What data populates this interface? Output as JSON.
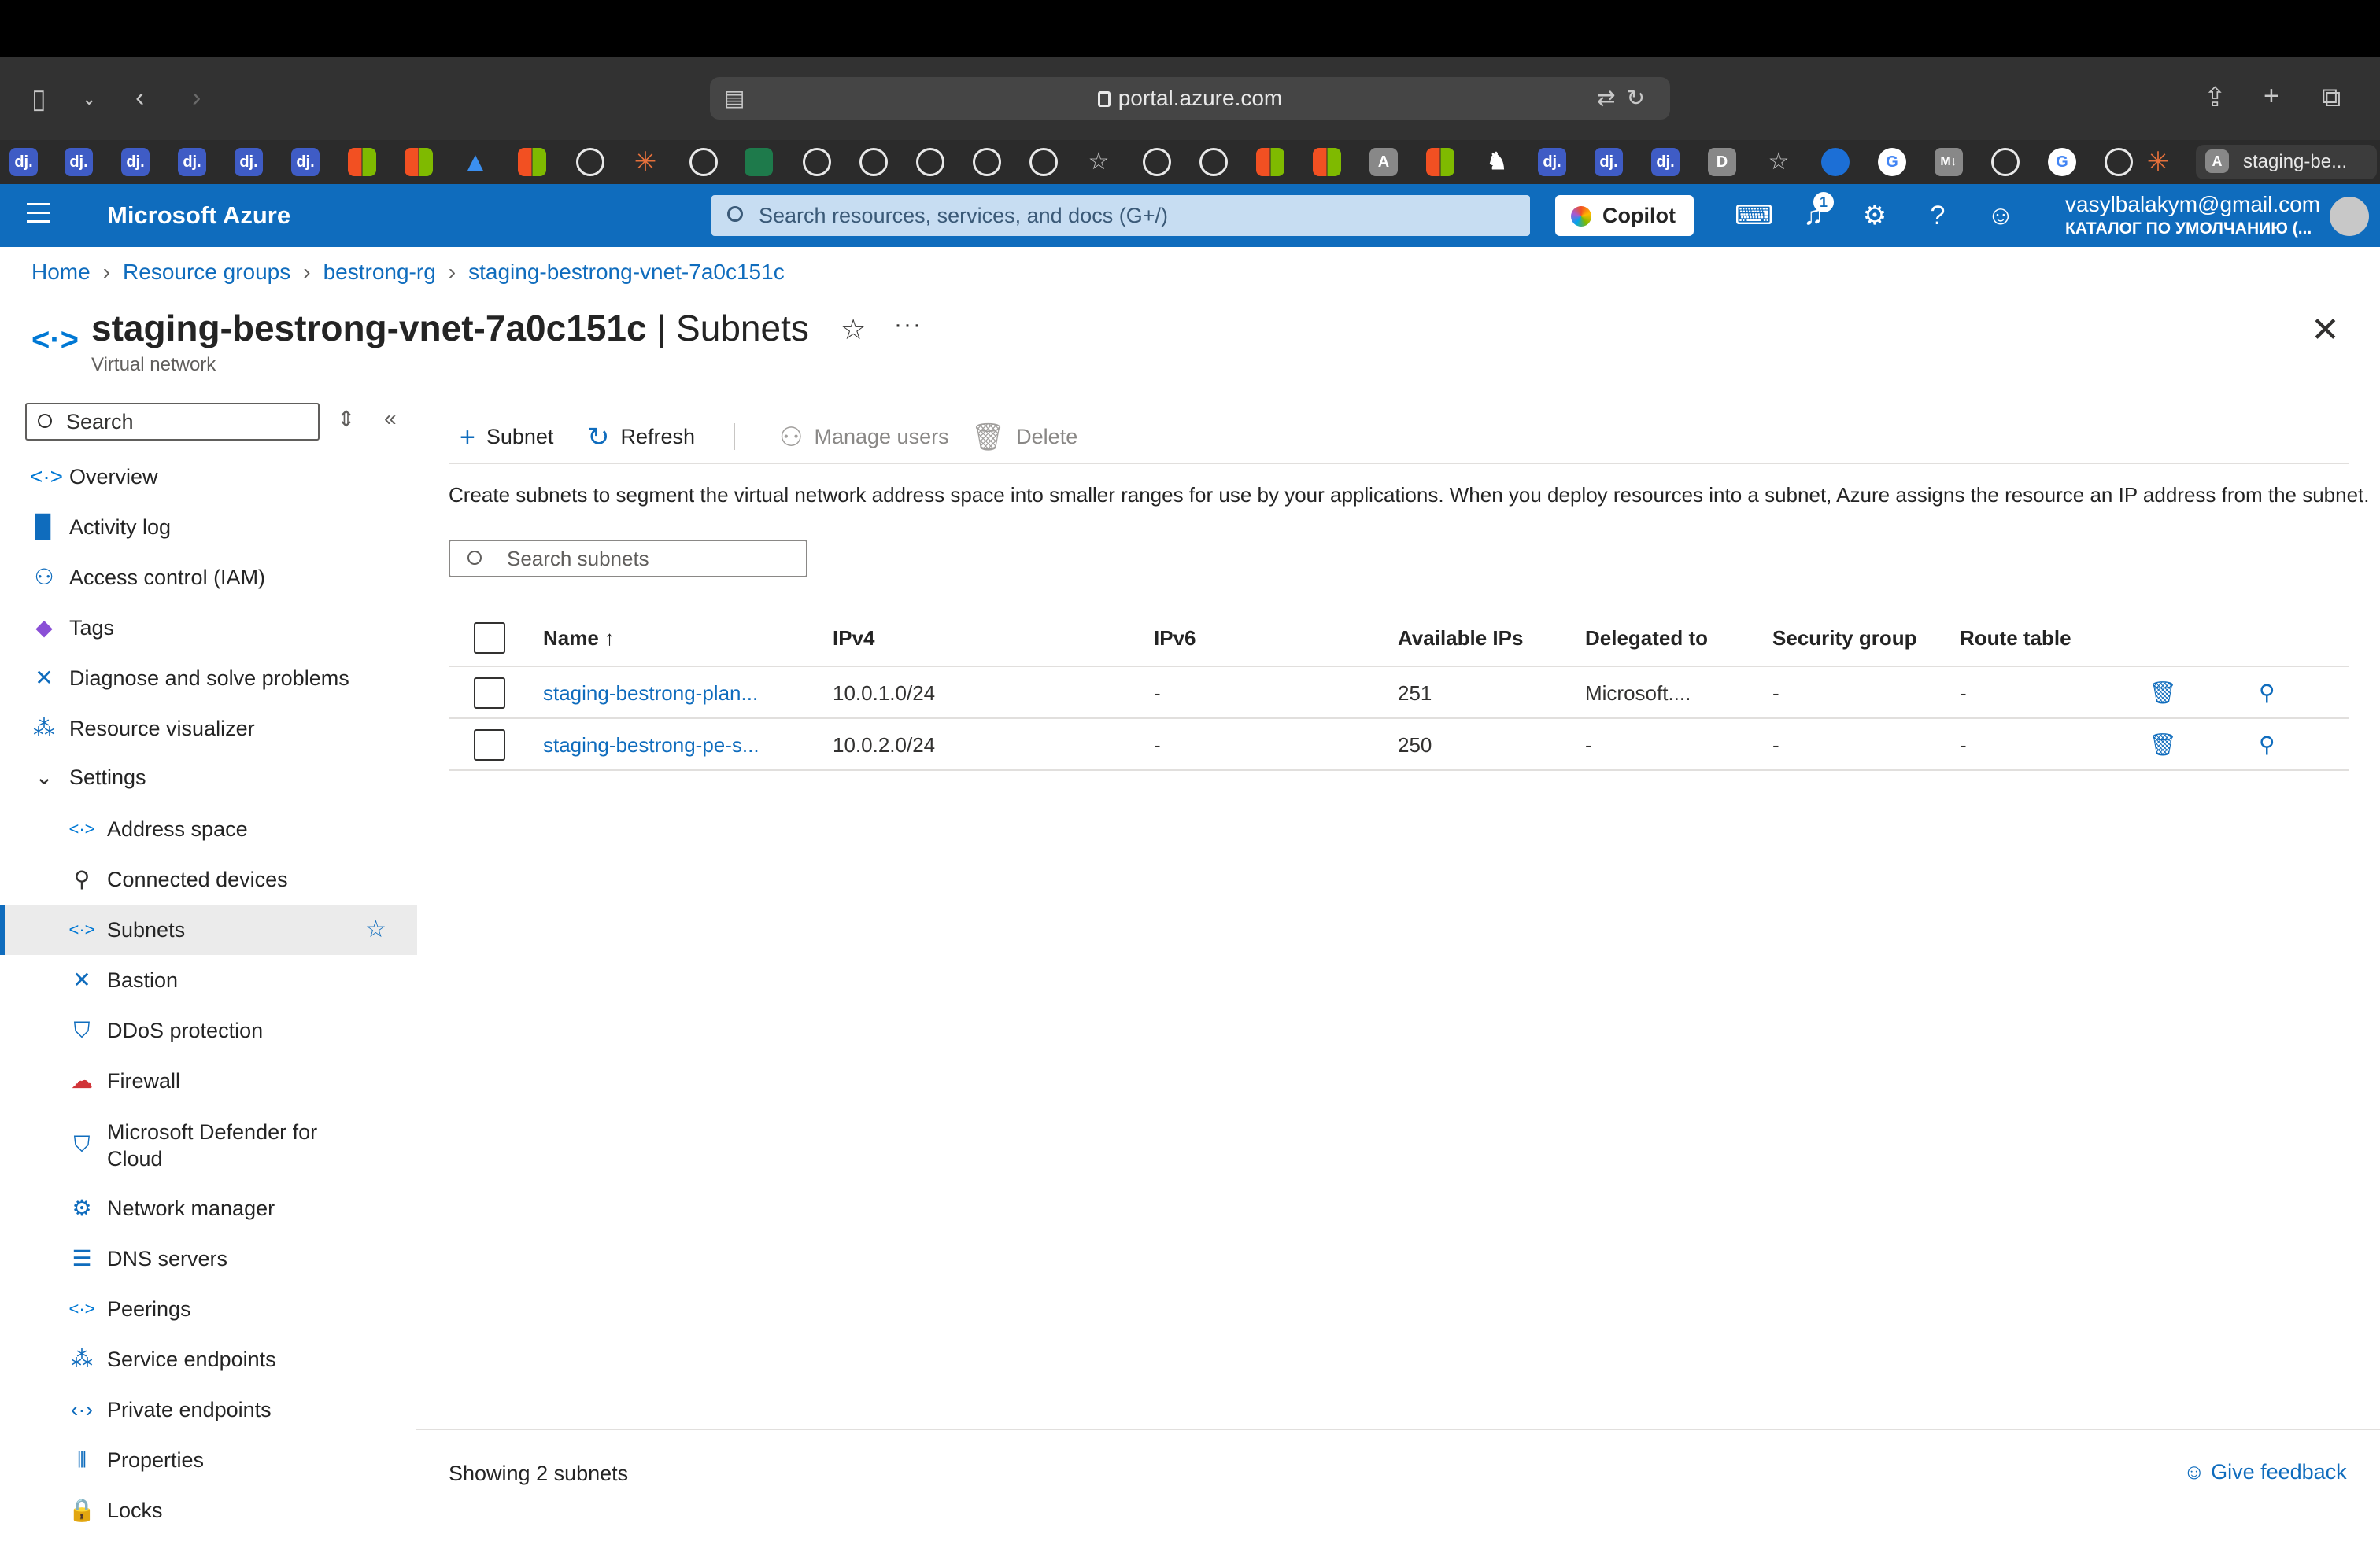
{
  "browser": {
    "url": "portal.azure.com",
    "tab_title": "staging-be...",
    "bookmarks": [
      "dj.",
      "dj.",
      "dj.",
      "dj.",
      "dj.",
      "dj.",
      "A",
      "D",
      "M↓",
      "A"
    ]
  },
  "header": {
    "brand": "Microsoft Azure",
    "search_placeholder": "Search resources, services, and docs (G+/)",
    "copilot_label": "Copilot",
    "notifications_count": "1",
    "user_email": "vasylbalakym@gmail.com",
    "user_directory": "КАТАЛОГ ПО УМОЛЧАНИЮ (..."
  },
  "breadcrumb": [
    "Home",
    "Resource groups",
    "bestrong-rg",
    "staging-bestrong-vnet-7a0c151c"
  ],
  "page": {
    "title_resource": "staging-bestrong-vnet-7a0c151c",
    "title_section": " | Subnets",
    "subtitle": "Virtual network"
  },
  "sidebar": {
    "search_placeholder": "Search",
    "items": [
      {
        "label": "Overview",
        "icon": "overview-icon"
      },
      {
        "label": "Activity log",
        "icon": "activity-log-icon"
      },
      {
        "label": "Access control (IAM)",
        "icon": "iam-icon"
      },
      {
        "label": "Tags",
        "icon": "tag-icon"
      },
      {
        "label": "Diagnose and solve problems",
        "icon": "diagnose-icon"
      },
      {
        "label": "Resource visualizer",
        "icon": "visualizer-icon"
      },
      {
        "label": "Settings",
        "icon": "chevron-down-icon"
      },
      {
        "label": "Address space",
        "icon": "address-space-icon"
      },
      {
        "label": "Connected devices",
        "icon": "connected-devices-icon"
      },
      {
        "label": "Subnets",
        "icon": "subnets-icon"
      },
      {
        "label": "Bastion",
        "icon": "bastion-icon"
      },
      {
        "label": "DDoS protection",
        "icon": "ddos-shield-icon"
      },
      {
        "label": "Firewall",
        "icon": "firewall-icon"
      },
      {
        "label": "Microsoft Defender for",
        "label2": "Cloud",
        "icon": "defender-shield-icon"
      },
      {
        "label": "Network manager",
        "icon": "network-manager-icon"
      },
      {
        "label": "DNS servers",
        "icon": "dns-icon"
      },
      {
        "label": "Peerings",
        "icon": "peerings-icon"
      },
      {
        "label": "Service endpoints",
        "icon": "service-endpoints-icon"
      },
      {
        "label": "Private endpoints",
        "icon": "private-endpoints-icon"
      },
      {
        "label": "Properties",
        "icon": "properties-icon"
      },
      {
        "label": "Locks",
        "icon": "lock-icon"
      }
    ]
  },
  "toolbar": {
    "add_subnet": "Subnet",
    "refresh": "Refresh",
    "manage_users": "Manage users",
    "delete": "Delete"
  },
  "description": "Create subnets to segment the virtual network address space into smaller ranges for use by your applications. When you deploy resources into a subnet, Azure assigns the resource an IP address from the subnet.",
  "subnet_search_placeholder": "Search subnets",
  "table": {
    "headers": [
      "Name ↑",
      "IPv4",
      "IPv6",
      "Available IPs",
      "Delegated to",
      "Security group",
      "Route table"
    ],
    "rows": [
      {
        "name": "staging-bestrong-plan...",
        "ipv4": "10.0.1.0/24",
        "ipv6": "-",
        "available": "251",
        "delegated": "Microsoft....",
        "nsg": "-",
        "route": "-"
      },
      {
        "name": "staging-bestrong-pe-s...",
        "ipv4": "10.0.2.0/24",
        "ipv6": "-",
        "available": "250",
        "delegated": "-",
        "nsg": "-",
        "route": "-"
      }
    ]
  },
  "footer": {
    "count_text": "Showing 2 subnets",
    "feedback": "Give feedback"
  },
  "colors": {
    "azure_blue": "#0f6cbd",
    "header_bg": "#0f6cbd"
  }
}
